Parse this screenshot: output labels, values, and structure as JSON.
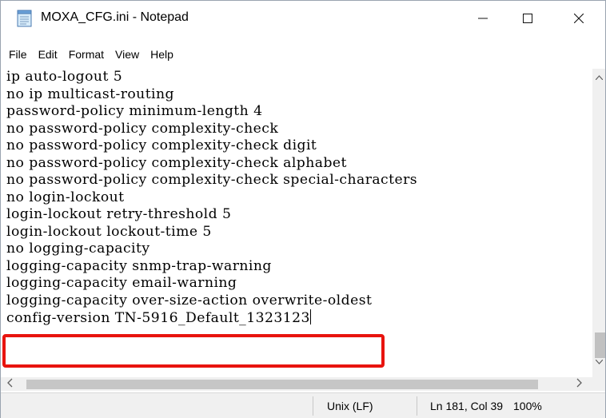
{
  "window": {
    "title": "MOXA_CFG.ini - Notepad",
    "controls": {
      "minimize": "—",
      "maximize": "☐",
      "close": "✕"
    }
  },
  "menu": [
    "File",
    "Edit",
    "Format",
    "View",
    "Help"
  ],
  "editor": {
    "lines": [
      "ip auto-logout 5",
      "no ip multicast-routing",
      "password-policy minimum-length 4",
      "no password-policy complexity-check",
      "no password-policy complexity-check digit",
      "no password-policy complexity-check alphabet",
      "no password-policy complexity-check special-characters",
      "no login-lockout",
      "login-lockout retry-threshold 5",
      "login-lockout lockout-time 5",
      "no logging-capacity",
      "logging-capacity snmp-trap-warning",
      "logging-capacity email-warning",
      "logging-capacity over-size-action overwrite-oldest",
      "config-version TN-5916_Default_1323123"
    ],
    "highlight_color": "#e8140e"
  },
  "statusbar": {
    "line_ending": "Unix (LF)",
    "position": "Ln 181, Col 39",
    "zoom": "100%"
  }
}
